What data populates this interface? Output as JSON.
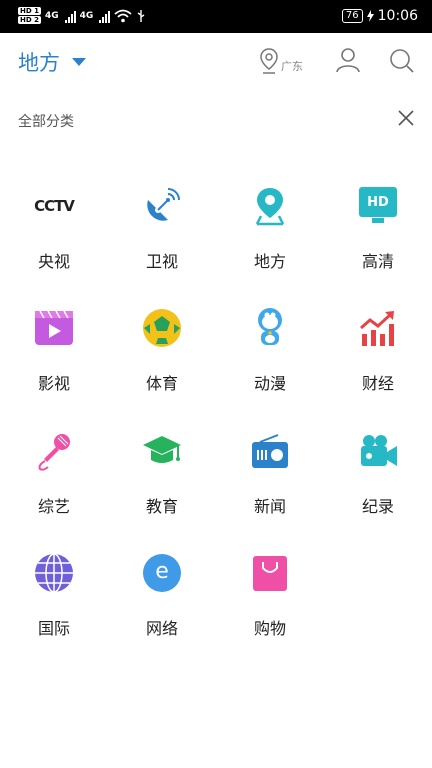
{
  "status_bar": {
    "sim1": "HD 1",
    "sim2": "HD 2",
    "net1": "4G",
    "net2": "4G",
    "battery": "76",
    "time": "10:06"
  },
  "header": {
    "region_label": "地方",
    "location_label": "广东"
  },
  "category_bar": {
    "title": "全部分类"
  },
  "categories": [
    {
      "label": "央视",
      "icon": "cctv-logo-icon",
      "icon_text": "CCTV"
    },
    {
      "label": "卫视",
      "icon": "satellite-dish-icon"
    },
    {
      "label": "地方",
      "icon": "map-pin-icon"
    },
    {
      "label": "高清",
      "icon": "hd-monitor-icon",
      "icon_text": "HD"
    },
    {
      "label": "影视",
      "icon": "film-play-icon"
    },
    {
      "label": "体育",
      "icon": "football-icon"
    },
    {
      "label": "动漫",
      "icon": "anime-character-icon"
    },
    {
      "label": "财经",
      "icon": "finance-chart-icon"
    },
    {
      "label": "综艺",
      "icon": "microphone-icon"
    },
    {
      "label": "教育",
      "icon": "graduation-cap-icon"
    },
    {
      "label": "新闻",
      "icon": "radio-icon"
    },
    {
      "label": "纪录",
      "icon": "video-camera-icon"
    },
    {
      "label": "国际",
      "icon": "globe-icon"
    },
    {
      "label": "网络",
      "icon": "e-network-icon",
      "icon_text": "e"
    },
    {
      "label": "购物",
      "icon": "shopping-bag-icon"
    }
  ],
  "colors": {
    "accent": "#2b82c9",
    "teal": "#27b8c6",
    "purple": "#6f5fd9",
    "pink": "#f04fa6",
    "green": "#27b25d",
    "red": "#e84344"
  }
}
